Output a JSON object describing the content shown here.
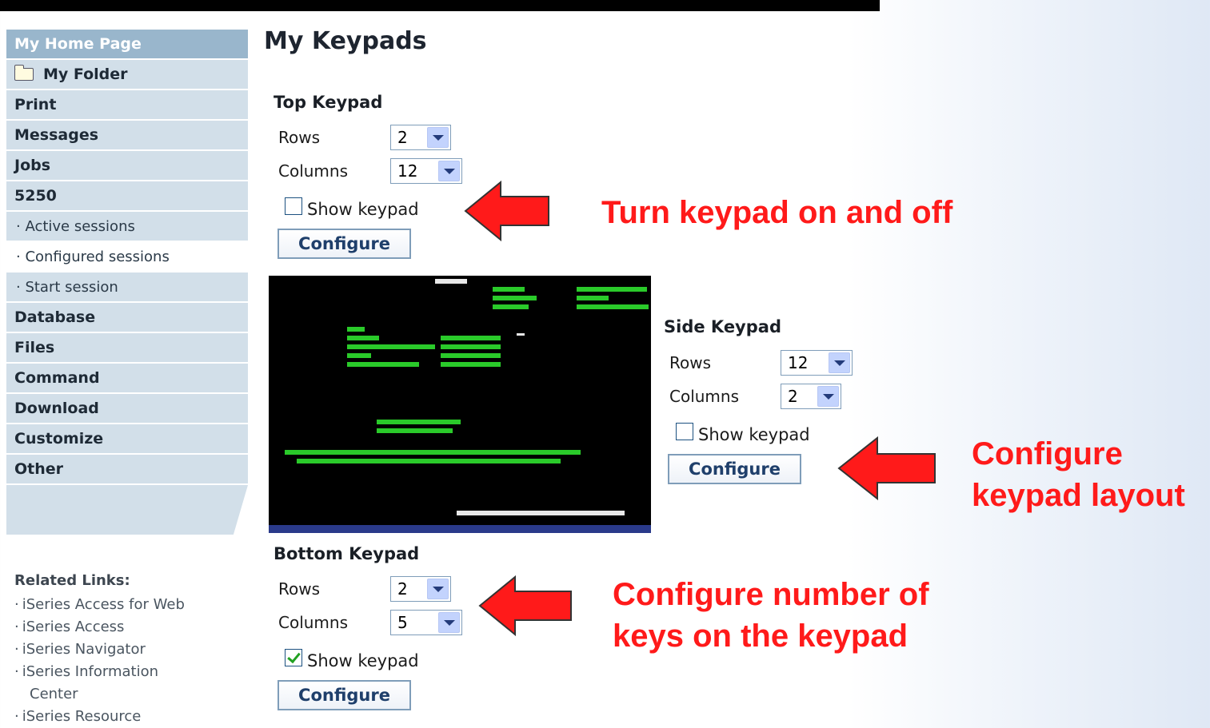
{
  "sidebar": {
    "items": [
      {
        "label": "My Home Page"
      },
      {
        "label": "My Folder"
      },
      {
        "label": "Print"
      },
      {
        "label": "Messages"
      },
      {
        "label": "Jobs"
      },
      {
        "label": "5250"
      },
      {
        "label": "· Active sessions"
      },
      {
        "label": "· Configured sessions"
      },
      {
        "label": "· Start session"
      },
      {
        "label": "Database"
      },
      {
        "label": "Files"
      },
      {
        "label": "Command"
      },
      {
        "label": "Download"
      },
      {
        "label": "Customize"
      },
      {
        "label": "Other"
      }
    ],
    "related": {
      "title": "Related Links:",
      "links": [
        "iSeries Access for Web",
        "iSeries Access",
        "iSeries Navigator",
        "iSeries Information",
        "Center",
        "iSeries Resource"
      ]
    }
  },
  "main": {
    "title": "My Keypads",
    "top": {
      "title": "Top Keypad",
      "rows_label": "Rows",
      "rows": "2",
      "cols_label": "Columns",
      "cols": "12",
      "show_label": "Show keypad",
      "show": false,
      "button": "Configure"
    },
    "side": {
      "title": "Side Keypad",
      "rows_label": "Rows",
      "rows": "12",
      "cols_label": "Columns",
      "cols": "2",
      "show_label": "Show keypad",
      "show": false,
      "button": "Configure"
    },
    "bottom": {
      "title": "Bottom Keypad",
      "rows_label": "Rows",
      "rows": "2",
      "cols_label": "Columns",
      "cols": "5",
      "show_label": "Show keypad",
      "show": true,
      "button": "Configure"
    }
  },
  "annotations": {
    "toggle": "Turn keypad on and off",
    "layout_1": "Configure",
    "layout_2": "keypad layout",
    "keys_1": "Configure number of",
    "keys_2": "keys on the keypad"
  },
  "colors": {
    "annotation": "#ff1a1a",
    "nav_bg": "#d2dfe9",
    "nav_home": "#99b6cc"
  }
}
